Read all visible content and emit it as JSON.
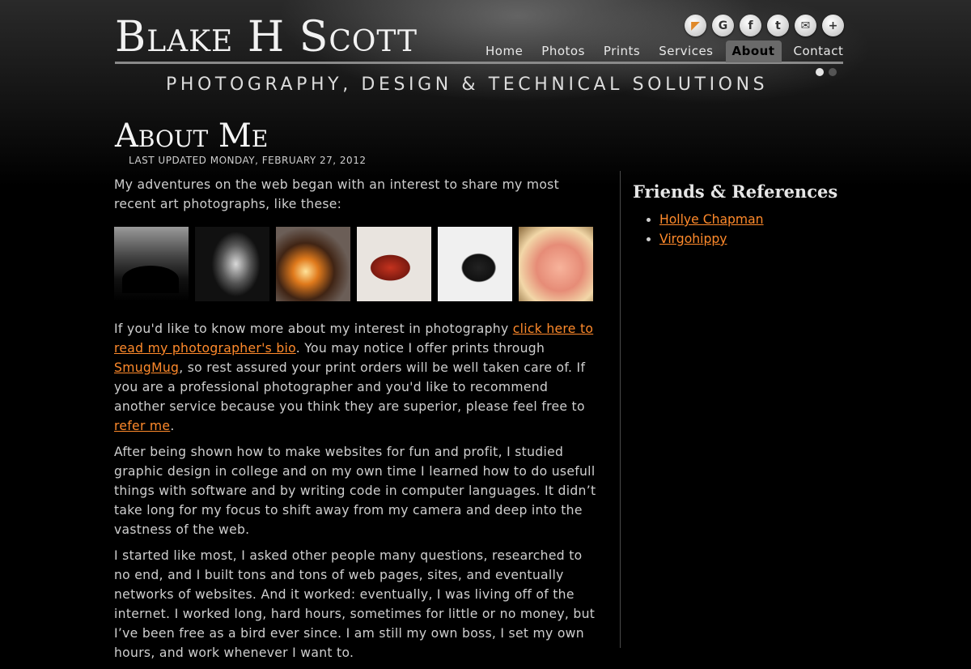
{
  "header": {
    "site_title": "Blake H Scott",
    "tagline": "PHOTOGRAPHY, DESIGN & TECHNICAL SOLUTIONS"
  },
  "social": [
    {
      "icon": "rss-icon",
      "glyph": "◤"
    },
    {
      "icon": "google-icon",
      "glyph": "G"
    },
    {
      "icon": "facebook-icon",
      "glyph": "f"
    },
    {
      "icon": "twitter-icon",
      "glyph": "t"
    },
    {
      "icon": "email-icon",
      "glyph": "✉"
    },
    {
      "icon": "plus-icon",
      "glyph": "+"
    }
  ],
  "nav": {
    "items": [
      "Home",
      "Photos",
      "Prints",
      "Services",
      "About",
      "Contact"
    ],
    "active": "About"
  },
  "page": {
    "title": "About Me",
    "updated": "Last updated Monday, February 27, 2012"
  },
  "content": {
    "intro": "My adventures on the web began with an interest to share my most recent art photographs, like these:",
    "p1_a": "If you'd like to know more about my interest in photography ",
    "p1_link1": "click here to read my photographer's bio",
    "p1_b": ". You may notice I offer prints through ",
    "p1_link2": "SmugMug",
    "p1_c": ", so rest assured your print orders will be well taken care of. If you are a professional photographer and you'd like to recommend another service because you think they are superior, please feel free to ",
    "p1_link3": "refer me",
    "p1_d": ".",
    "p2": "After being shown how to make websites for fun and profit, I studied graphic design in college and on my own time I learned how to do usefull things with software and by writing code in computer languages. It didn’t take long for my focus to shift away from my camera and deep into the vastness of the web.",
    "p3": "I started like most, I asked other people many questions, researched to no end, and I built tons and tons of web pages, sites, and eventually networks of websites. And it worked: eventually, I was living off of the internet. I worked long, hard hours, sometimes for little or no money, but I’ve been free as a bird ever since. I am still my own boss, I set my own hours, and work whenever I want to."
  },
  "sidebar": {
    "title": "Friends & References",
    "links": [
      "Hollye Chapman",
      "Virgohippy"
    ]
  },
  "colors": {
    "link": "#ff8a2b",
    "background": "#000000",
    "nav_active_bg": "#6a6a6a"
  }
}
